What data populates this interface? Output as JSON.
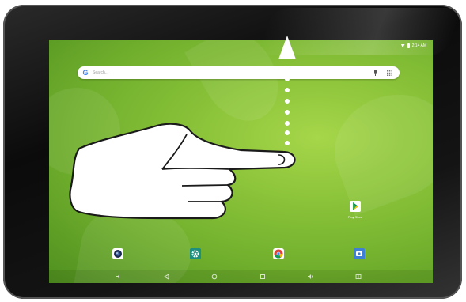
{
  "status_bar": {
    "time": "2:14 AM",
    "icons": [
      "wifi-icon",
      "battery-icon"
    ]
  },
  "search_bar": {
    "placeholder": "Search...",
    "logo": "G"
  },
  "home_apps": [
    {
      "label": "Play Store",
      "icon": "play-store-icon"
    }
  ],
  "dock": [
    "camera-icon",
    "settings-icon",
    "chrome-icon",
    "gallery-icon"
  ],
  "nav_bar": [
    "volume-down-icon",
    "back-icon",
    "home-icon",
    "recents-icon",
    "volume-up-icon",
    "screenshot-icon"
  ],
  "gesture": {
    "hint": "swipe-up",
    "icon": "hand-pointer-icon"
  },
  "colors": {
    "wallpaper": "#8cc43a",
    "play_accent": "#01875f",
    "settings": "#1e8e7e",
    "chrome_red": "#db4437",
    "gallery": "#3f7fd6"
  }
}
